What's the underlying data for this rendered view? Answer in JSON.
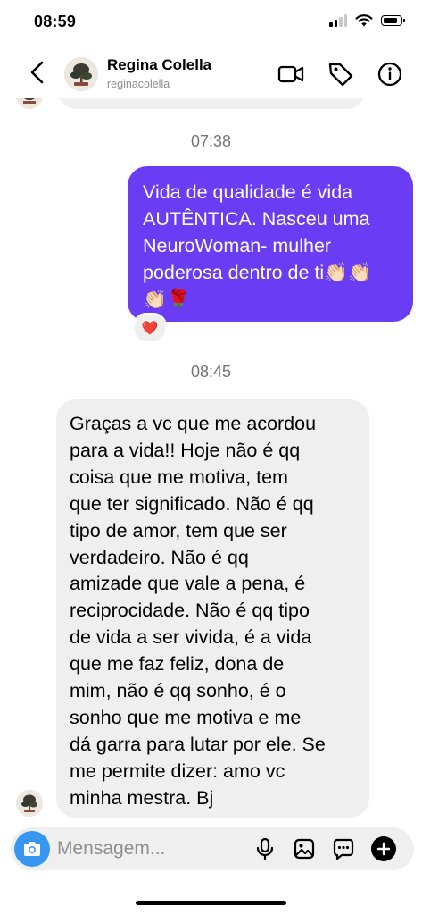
{
  "status_bar": {
    "time": "08:59"
  },
  "header": {
    "name": "Regina Colella",
    "username": "reginacolella",
    "icons": [
      "back-chevron-icon",
      "video-camera-icon",
      "tag-icon",
      "info-icon"
    ]
  },
  "conversation": {
    "timestamp_1": "07:38",
    "outgoing_message": "Vida de qualidade é vida AUTÊNTICA. Nasceu uma NeuroWoman- mulher poderosa dentro de ti👏🏻👏🏻👏🏻🌹",
    "outgoing_lines": [
      "Vida de qualidade é vida",
      "AUTÊNTICA. Nasceu uma",
      "NeuroWoman- mulher",
      "poderosa dentro de ti👏🏻👏🏻",
      "👏🏻🌹"
    ],
    "reaction": "❤️",
    "timestamp_2": "08:45",
    "incoming_message_lines": [
      "Graças a vc que me acordou",
      "para a vida!! Hoje não é qq",
      "coisa que me motiva, tem",
      "que ter significado. Não é qq",
      "tipo de amor, tem que ser",
      "verdadeiro. Não é qq",
      "amizade que vale a pena, é",
      "reciprocidade. Não é qq tipo",
      "de vida a ser vivida, é a vida",
      "que me faz feliz, dona de",
      "mim, não é qq sonho, é o",
      "sonho que me motiva e me",
      "dá garra para lutar por ele. Se",
      "me permite dizer: amo vc",
      "minha mestra. Bj"
    ]
  },
  "composer": {
    "placeholder": "Mensagem...",
    "icons": [
      "camera-icon",
      "microphone-icon",
      "gallery-icon",
      "sticker-chat-icon",
      "plus-icon"
    ]
  },
  "colors": {
    "outgoing_bubble": "#6a3df5",
    "incoming_bubble": "#efefef",
    "camera_button": "#3797f0",
    "timestamp": "#737373"
  }
}
